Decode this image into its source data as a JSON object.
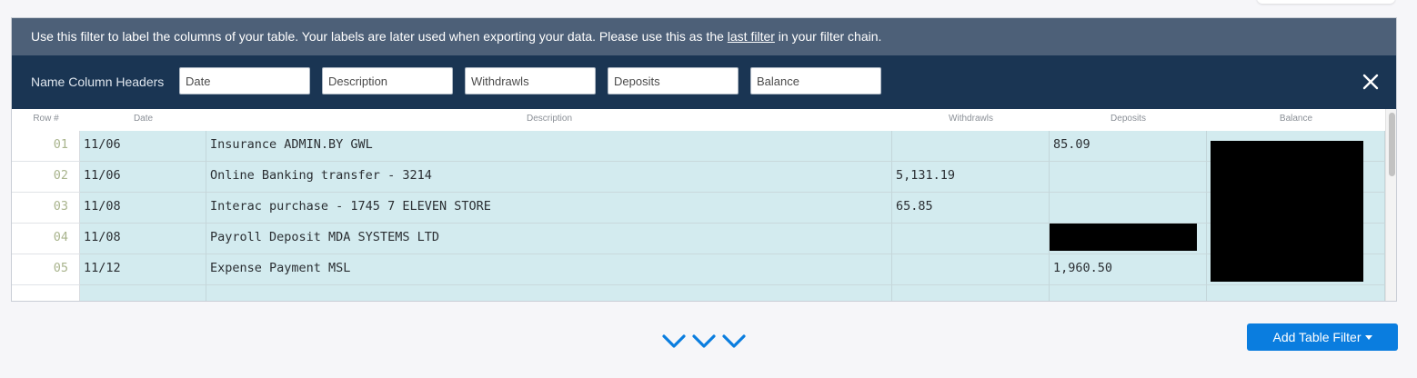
{
  "info_bar": {
    "text_before": "Use this filter to label the columns of your table. Your labels are later used when exporting your data. Please use this as the ",
    "link": "last filter",
    "text_after": " in your filter chain."
  },
  "header": {
    "label": "Name Column Headers",
    "inputs": [
      {
        "value": "Date"
      },
      {
        "value": "Description"
      },
      {
        "value": "Withdrawls"
      },
      {
        "value": "Deposits"
      },
      {
        "value": "Balance"
      }
    ],
    "close_icon": "close-icon"
  },
  "table": {
    "columns": [
      "Row #",
      "Date",
      "Description",
      "Withdrawls",
      "Deposits",
      "Balance"
    ],
    "rows": [
      {
        "num": "01",
        "date": "11/06",
        "description": "Insurance ADMIN.BY GWL",
        "withdrawls": "",
        "deposits": "85.09"
      },
      {
        "num": "02",
        "date": "11/06",
        "description": "Online Banking transfer - 3214",
        "withdrawls": "5,131.19",
        "deposits": ""
      },
      {
        "num": "03",
        "date": "11/08",
        "description": "Interac purchase - 1745 7 ELEVEN STORE",
        "withdrawls": "65.85",
        "deposits": ""
      },
      {
        "num": "04",
        "date": "11/08",
        "description": "Payroll Deposit MDA SYSTEMS LTD",
        "withdrawls": "",
        "deposits": ""
      },
      {
        "num": "05",
        "date": "11/12",
        "description": "Expense Payment MSL",
        "withdrawls": "",
        "deposits": "1,960.50"
      }
    ]
  },
  "footer": {
    "expand_icon": "triple-chevron-down-icon",
    "add_filter_label": "Add Table Filter"
  },
  "colors": {
    "info_bar": "#4d6078",
    "header_bar": "#1a3553",
    "cell_fill": "#d3ebef",
    "primary_button": "#0a7ddf",
    "chevron": "#0a7ddf"
  }
}
